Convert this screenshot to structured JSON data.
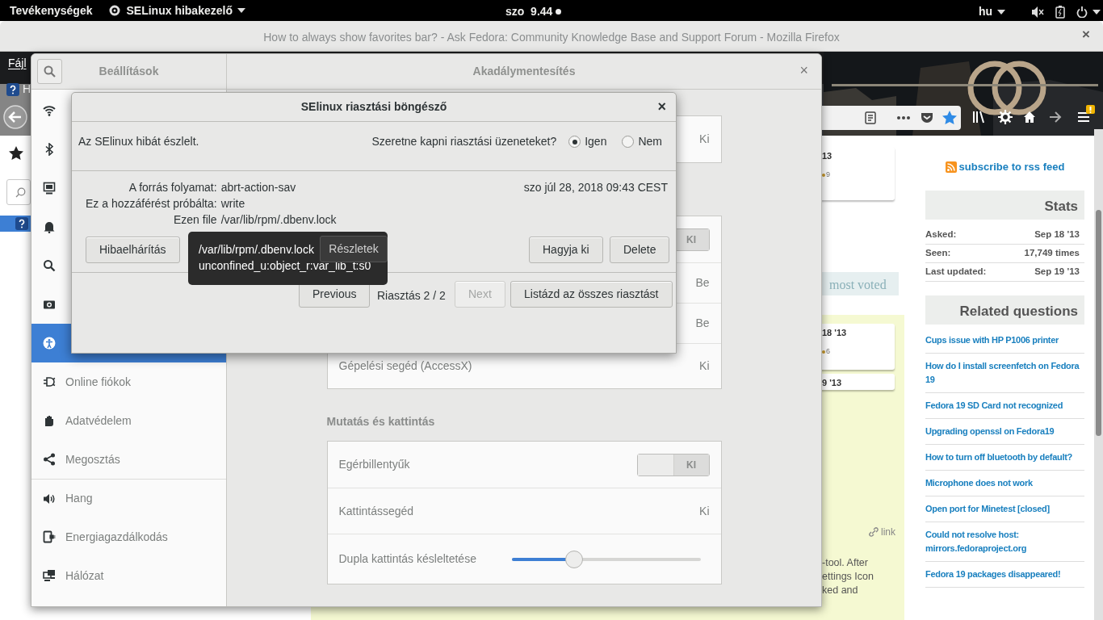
{
  "top_bar": {
    "activities": "Tevékenységek",
    "app_menu": "SELinux hibakezelő",
    "clock": "szo  9.44",
    "keyboard_layout": "hu"
  },
  "firefox": {
    "title": "How to always show favorites bar? - Ask Fedora: Community Knowledge Base and Support Forum - Mozilla Firefox",
    "close": "×",
    "menu": "Fájl",
    "tab_fragment": "H",
    "question_cards": [
      {
        "date": "13",
        "score": "9"
      },
      {
        "date": "18 '13",
        "score": "6"
      },
      {
        "date": "9 '13"
      }
    ],
    "sort_tab": "most voted",
    "permalink": "link",
    "answer_lines": [
      "-tool. After",
      "ettings Icon",
      "ked and"
    ],
    "rss_link": "subscribe to rss feed",
    "stats": {
      "title": "Stats",
      "rows": [
        {
          "label": "Asked:",
          "value": "Sep 18 '13"
        },
        {
          "label": "Seen:",
          "value": "17,749 times"
        },
        {
          "label": "Last updated:",
          "value": "Sep 19 '13"
        }
      ]
    },
    "related": {
      "title": "Related questions",
      "links": [
        "Cups issue with HP P1006 printer",
        "How do I install screenfetch on Fedora 19",
        "Fedora 19 SD Card not recognized",
        "Upgrading openssl on Fedora19",
        "How to turn off bluetooth by default?",
        "Microphone does not work",
        "Open port for Minetest [closed]",
        "Could not resolve host: mirrors.fedoraproject.org",
        "Fedora 19 packages disappeared!"
      ]
    }
  },
  "settings": {
    "title": "Beállítások",
    "panel_title": "Akadálymentesítés",
    "close": "×",
    "sidebar": [
      {
        "selected": false
      },
      {
        "selected": false
      },
      {
        "selected": false
      },
      {
        "selected": false
      },
      {
        "selected": false
      },
      {
        "selected": false
      },
      {
        "selected": true
      },
      {
        "label": "Online fiókok",
        "selected": false
      },
      {
        "label": "Adatvédelem",
        "selected": false
      },
      {
        "label": "Megosztás",
        "selected": false
      },
      {
        "label": "Hang",
        "selected": false,
        "separator_before": true
      },
      {
        "label": "Energiagazdálkodás",
        "selected": false
      },
      {
        "label": "Hálózat",
        "selected": false
      }
    ],
    "groups": [
      {
        "rows": [
          {
            "kind": "value",
            "value": "Ki"
          }
        ]
      },
      {
        "rows": [
          {
            "kind": "toggle",
            "on": false,
            "value": "KI"
          },
          {
            "kind": "value",
            "value": "Be"
          },
          {
            "kind": "value",
            "value": "Be"
          },
          {
            "kind": "value",
            "label": "Gépelési segéd (AccessX)",
            "value": "Ki"
          }
        ]
      },
      {
        "heading": "Mutatás és kattintás",
        "rows": [
          {
            "kind": "toggle",
            "label": "Egérbillentyűk",
            "on": false,
            "value": "KI"
          },
          {
            "kind": "value",
            "label": "Kattintássegéd",
            "value": "Ki"
          },
          {
            "kind": "slider",
            "label": "Dupla kattintás késleltetése",
            "level": 0.33
          }
        ]
      }
    ]
  },
  "dialog": {
    "title": "SElinux riasztási böngésző",
    "close": "×",
    "message": "Az SElinux hibát észlelt.",
    "question": "Szeretne kapni riasztási üzeneteket?",
    "options": [
      {
        "label": "Igen",
        "selected": true
      },
      {
        "label": "Nem",
        "selected": false
      }
    ],
    "details": [
      {
        "label": "A forrás folyamat:",
        "value": "abrt-action-sav"
      },
      {
        "label": "Ez a hozzáférést próbálta:",
        "value": "write"
      },
      {
        "label": "Ezen file",
        "value": "/var/lib/rpm/.dbenv.lock"
      }
    ],
    "timestamp": "szo júl 28, 2018 09:43 CEST",
    "troubleshoot": "Hibaelhárítás",
    "details_button": "Részletek",
    "ignore": "Hagyja ki",
    "delete": "Delete",
    "previous": "Previous",
    "counter": "Riasztás 2 / 2",
    "next": {
      "label": "Next",
      "disabled": true
    },
    "list_all": "Listázd az összes riasztást"
  },
  "tooltip": {
    "lines": [
      "/var/lib/rpm/.dbenv.lock",
      "unconfined_u:object_r:var_lib_t:s0"
    ]
  }
}
